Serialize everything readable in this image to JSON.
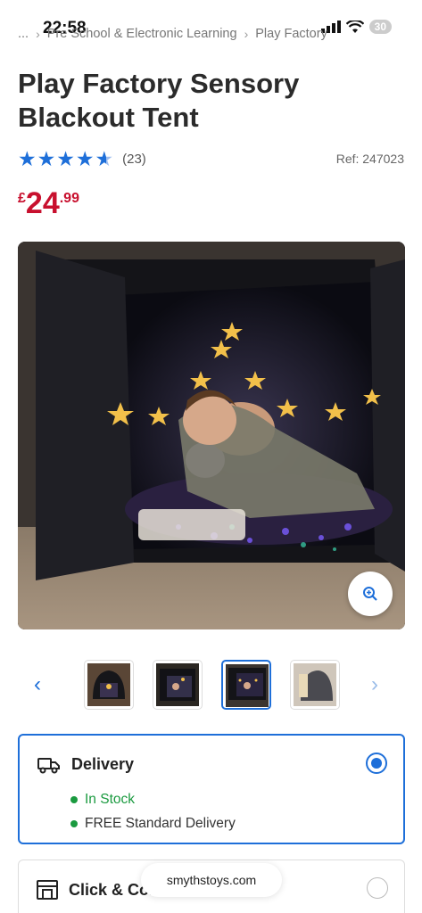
{
  "status": {
    "time": "22:58",
    "battery": "30"
  },
  "breadcrumb": {
    "ellipsis": "...",
    "category": "Pre School & Electronic Learning",
    "current": "Play Factory"
  },
  "product": {
    "title": "Play Factory Sensory Blackout Tent",
    "rating": 4.6,
    "review_count": "(23)",
    "ref": "Ref: 247023",
    "price": {
      "currency": "£",
      "whole": "24",
      "decimal": ".99"
    }
  },
  "gallery": {
    "thumbnails": 4,
    "active_index": 2
  },
  "delivery": {
    "label": "Delivery",
    "stock": "In Stock",
    "shipping": "FREE Standard Delivery",
    "selected": true
  },
  "collect": {
    "label": "Click & Collect",
    "selected": false
  },
  "browser": {
    "url": "smythstoys.com"
  },
  "colors": {
    "accent": "#1e6fd9",
    "price": "#c8102e",
    "stock": "#1a9a3f"
  }
}
